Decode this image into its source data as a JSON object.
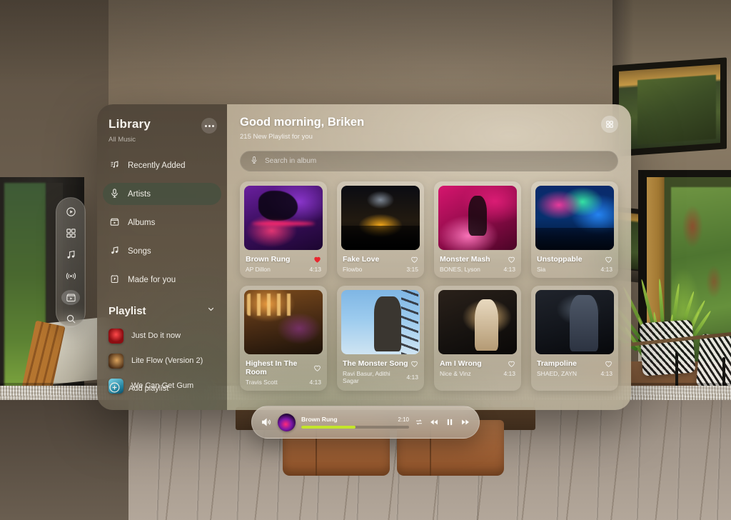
{
  "dock": {
    "items": [
      {
        "name": "play-circle-icon",
        "label": "Play",
        "active": false
      },
      {
        "name": "grid-icon",
        "label": "Browse",
        "active": false
      },
      {
        "name": "music-note-icon",
        "label": "Music",
        "active": false
      },
      {
        "name": "radio-icon",
        "label": "Radio",
        "active": false
      },
      {
        "name": "albums-icon",
        "label": "Albums",
        "active": true
      },
      {
        "name": "search-icon",
        "label": "Search",
        "active": false
      }
    ]
  },
  "sidebar": {
    "title": "Library",
    "subtitle": "All Music",
    "more_label": "More options",
    "nav": [
      {
        "label": "Recently Added",
        "icon": "recently-added-icon",
        "active": false
      },
      {
        "label": "Artists",
        "icon": "microphone-icon",
        "active": true
      },
      {
        "label": "Albums",
        "icon": "album-box-icon",
        "active": false
      },
      {
        "label": "Songs",
        "icon": "music-note-icon",
        "active": false
      },
      {
        "label": "Made for you",
        "icon": "made-for-you-icon",
        "active": false
      }
    ],
    "playlist_header": "Playlist",
    "playlists": [
      {
        "label": "Just Do it now",
        "thumb": "pl-t1"
      },
      {
        "label": "Lite Flow (Version 2)",
        "thumb": "pl-t2"
      },
      {
        "label": "We Can Get Gum",
        "thumb": "pl-t3"
      }
    ],
    "add_playlist": "Add playlist"
  },
  "header": {
    "greeting": "Good morning, Briken",
    "subtitle": "215 New Playlist for you",
    "grid_button_label": "Grid view"
  },
  "search": {
    "placeholder": "Search in album",
    "value": ""
  },
  "cards": [
    {
      "title": "Brown Rung",
      "artist": "AP Dillon",
      "duration": "4:13",
      "liked": true,
      "art": "a-dj"
    },
    {
      "title": "Fake Love",
      "artist": "Flowbo",
      "duration": "3:15",
      "liked": false,
      "art": "a-crowd"
    },
    {
      "title": "Monster Mash",
      "artist": "BONES, Lyson",
      "duration": "4:13",
      "liked": false,
      "art": "a-pink"
    },
    {
      "title": "Unstoppable",
      "artist": "Sia",
      "duration": "4:13",
      "liked": false,
      "art": "a-rainbow"
    },
    {
      "title": "Highest In The Room",
      "artist": "Travis Scott",
      "duration": "4:13",
      "liked": false,
      "art": "a-studio"
    },
    {
      "title": "The Monster Song",
      "artist": "Ravi Basur, Adithi Sagar",
      "duration": "4:13",
      "liked": false,
      "art": "a-sky"
    },
    {
      "title": "Am I Wrong",
      "artist": "Nice & Vinz",
      "duration": "4:13",
      "liked": false,
      "art": "a-mic1"
    },
    {
      "title": "Trampoline",
      "artist": "SHAED, ZAYN",
      "duration": "4:13",
      "liked": false,
      "art": "a-mic2"
    }
  ],
  "player": {
    "now_playing_title": "Brown Rung",
    "time": "2:10",
    "progress_percent": 50,
    "progress_color": "#c4e62a",
    "buttons": {
      "volume": "Volume",
      "repeat": "Repeat",
      "previous": "Previous",
      "pause": "Pause",
      "next": "Next"
    }
  },
  "accent": {
    "liked_heart": "#e8262f",
    "active_pill": "#44504 0"
  }
}
